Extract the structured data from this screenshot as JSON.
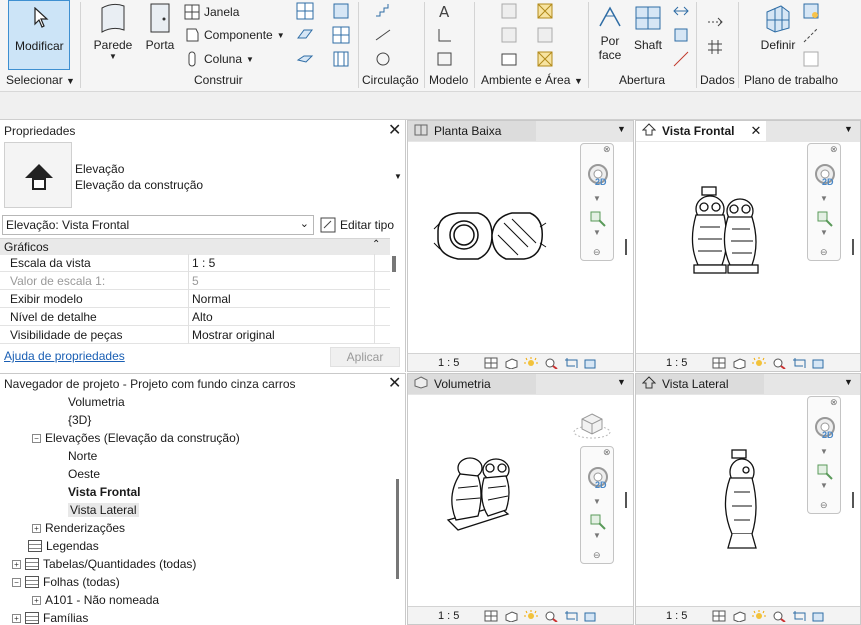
{
  "ribbon": {
    "modify": "Modificar",
    "select": "Selecionar",
    "wall": "Parede",
    "door": "Porta",
    "window": "Janela",
    "component": "Componente",
    "column": "Coluna",
    "build": "Construir",
    "circulation": "Circulação",
    "model": "Modelo",
    "room_area": "Ambiente e Área",
    "by_face_1": "Por",
    "by_face_2": "face",
    "shaft": "Shaft",
    "opening": "Abertura",
    "datum": "Dados",
    "set": "Definir",
    "workplane": "Plano de trabalho"
  },
  "properties": {
    "title": "Propriedades",
    "family": "Elevação",
    "type": "Elevação da construção",
    "selector": "Elevação: Vista Frontal",
    "edit_type": "Editar tipo",
    "group": "Gráficos",
    "rows": [
      {
        "k": "Escala da vista",
        "v": "1 : 5"
      },
      {
        "k": "Valor de escala    1:",
        "v": "5"
      },
      {
        "k": "Exibir modelo",
        "v": "Normal"
      },
      {
        "k": "Nível de detalhe",
        "v": "Alto"
      },
      {
        "k": "Visibilidade de peças",
        "v": "Mostrar original"
      }
    ],
    "help": "Ajuda de propriedades",
    "apply": "Aplicar"
  },
  "browser": {
    "title": "Navegador de projeto - Projeto com fundo cinza carros",
    "items": [
      "Volumetria",
      "{3D}",
      "Elevações (Elevação da construção)",
      "Norte",
      "Oeste",
      "Vista Frontal",
      "Vista Lateral",
      "Renderizações",
      "Legendas",
      "Tabelas/Quantidades (todas)",
      "Folhas (todas)",
      "A101 - Não nomeada",
      "Famílias"
    ]
  },
  "views": {
    "plan": "Planta Baixa",
    "front": "Vista Frontal",
    "iso": "Volumetria",
    "side": "Vista Lateral",
    "scale": "1 : 5",
    "nav2d": "2D"
  },
  "colors": {
    "accent": "#cce4f7",
    "select_border": "#3d8fd1"
  }
}
